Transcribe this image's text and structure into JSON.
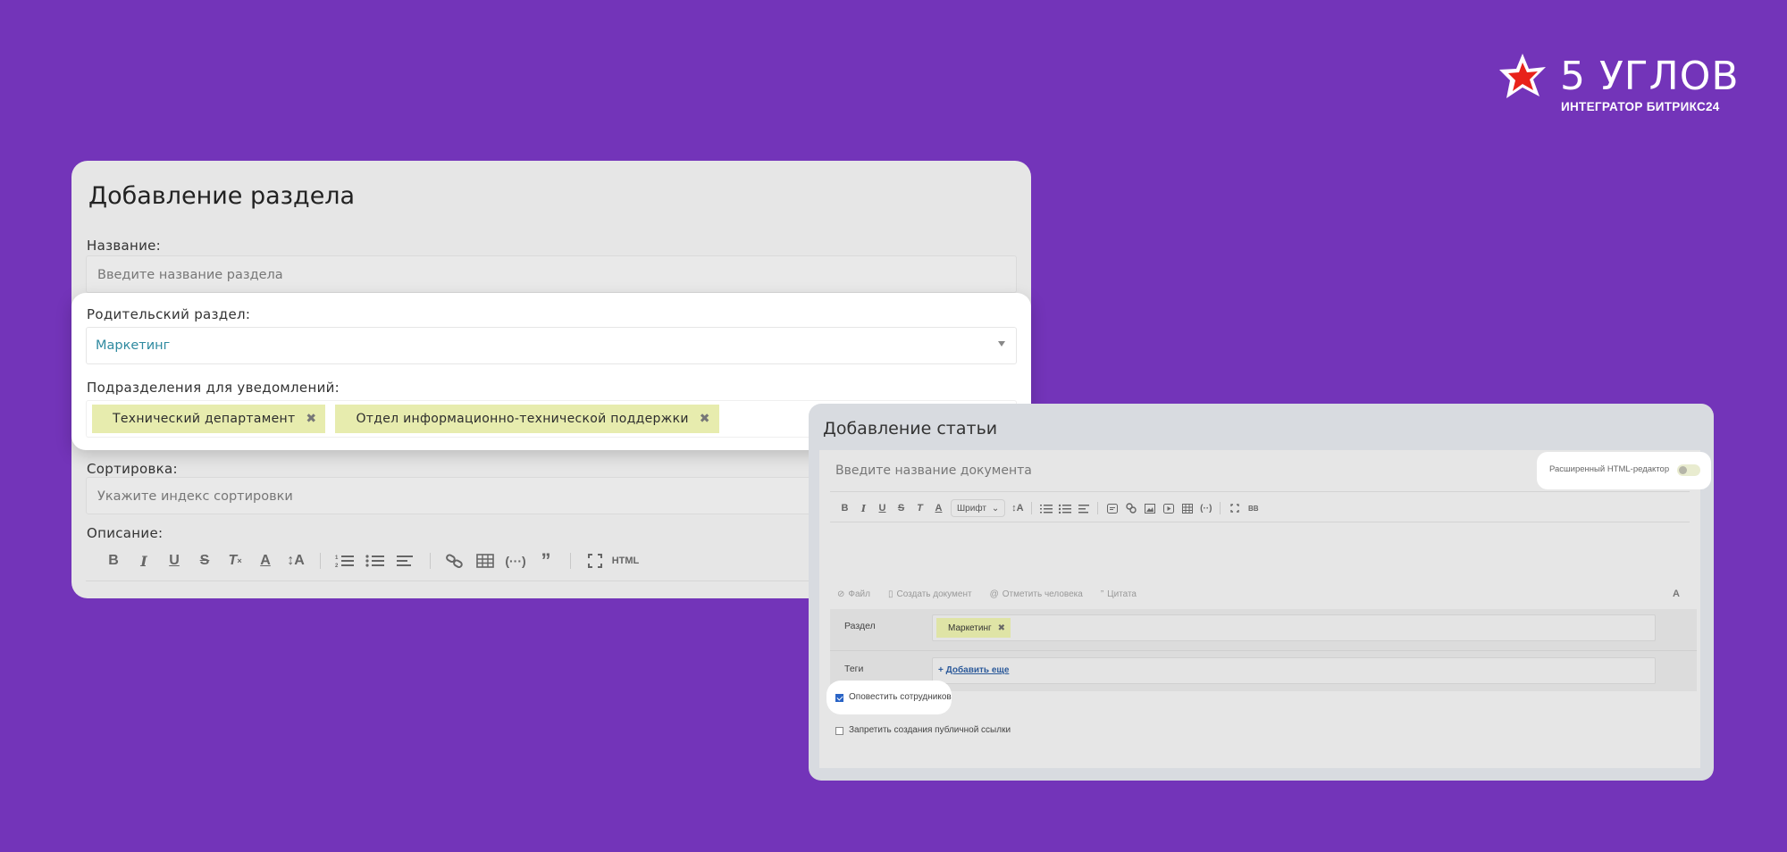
{
  "logo": {
    "brand": "5 УГЛОВ",
    "tagline": "ИНТЕГРАТОР БИТРИКС24",
    "star_color": "#e8221a"
  },
  "section_form": {
    "title": "Добавление раздела",
    "name_label": "Название:",
    "name_placeholder": "Введите название раздела",
    "parent_label": "Родительский раздел:",
    "parent_value": "Маркетинг",
    "notify_label": "Подразделения для уведомлений:",
    "departments": [
      "Технический департамент",
      "Отдел информационно-технической поддержки"
    ],
    "sort_label": "Сортировка:",
    "sort_placeholder": "Укажите индекс сортировки",
    "desc_label": "Описание:",
    "toolbar_html_label": "HTML"
  },
  "article_form": {
    "title": "Добавление статьи",
    "doc_placeholder": "Введите название документа",
    "html_editor_label": "Расширенный HTML-редактор",
    "font_label": "Шрифт",
    "actions": [
      "Файл",
      "Создать документ",
      "Отметить человека",
      "Цитата"
    ],
    "format_label": "A",
    "section_label": "Раздел",
    "section_value": "Маркетинг",
    "tags_label": "Теги",
    "add_more_label": "Добавить еще",
    "notify_employees_label": "Оповестить сотрудников",
    "forbid_public_link_label": "Запретить создания публичной ссылки"
  },
  "colors": {
    "background": "#7334b9",
    "tag_chip": "#e7ecae",
    "parent_value_text": "#2f8aa0",
    "checkbox_checked": "#2a64c6"
  }
}
